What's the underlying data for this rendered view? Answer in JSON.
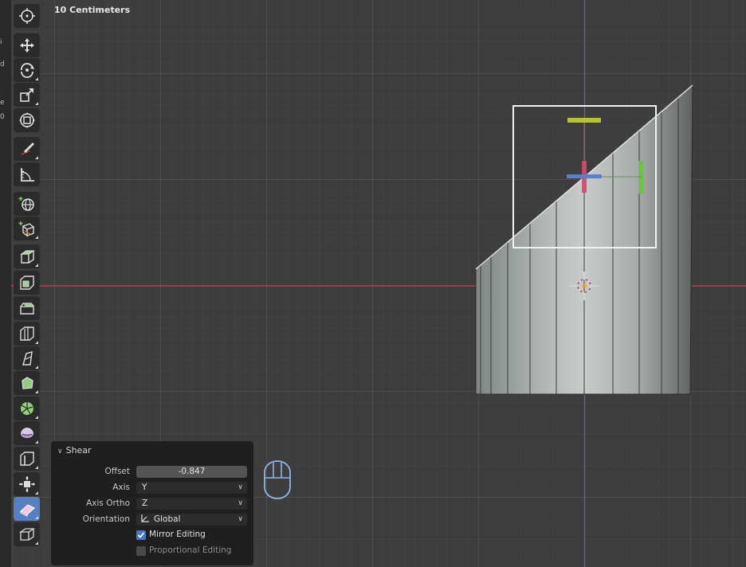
{
  "viewport": {
    "units_label": "10 Centimeters",
    "left_strip_chars": [
      "i",
      "d",
      "e",
      "0"
    ]
  },
  "toolbar": {
    "tools": [
      {
        "name": "cursor-tool-button",
        "icon": "cursor-target-icon",
        "active": false
      },
      {
        "name": "move-tool-button",
        "icon": "move-arrows-icon",
        "active": false
      },
      {
        "name": "rotate-tool-button",
        "icon": "rotate-icon",
        "active": false
      },
      {
        "name": "scale-tool-button",
        "icon": "scale-icon",
        "active": false
      },
      {
        "name": "transform-tool-button",
        "icon": "transform-icon",
        "active": false
      },
      {
        "name": "annotate-tool-button",
        "icon": "annotate-pen-icon",
        "active": false
      },
      {
        "name": "measure-tool-button",
        "icon": "measure-ruler-icon",
        "active": false
      },
      {
        "name": "add-object-tool-button",
        "icon": "add-globe-icon",
        "active": false
      },
      {
        "name": "add-cube-tool-button",
        "icon": "add-cube-icon",
        "active": false
      },
      {
        "name": "extrude-tool-button",
        "icon": "extrude-icon",
        "active": false
      },
      {
        "name": "inset-tool-button",
        "icon": "inset-icon",
        "active": false
      },
      {
        "name": "bevel-tool-button",
        "icon": "bevel-icon",
        "active": false
      },
      {
        "name": "loop-cut-tool-button",
        "icon": "loop-cut-icon",
        "active": false
      },
      {
        "name": "knife-tool-button",
        "icon": "knife-icon",
        "active": false
      },
      {
        "name": "poly-build-tool-button",
        "icon": "poly-build-icon",
        "active": false
      },
      {
        "name": "spin-tool-button",
        "icon": "spin-icon",
        "active": false
      },
      {
        "name": "smooth-tool-button",
        "icon": "smooth-sphere-icon",
        "active": false
      },
      {
        "name": "edge-slide-tool-button",
        "icon": "edge-slide-icon",
        "active": false
      },
      {
        "name": "shrink-fatten-tool-button",
        "icon": "shrink-fatten-icon",
        "active": false
      },
      {
        "name": "shear-tool-button",
        "icon": "shear-icon",
        "active": true
      },
      {
        "name": "rip-region-tool-button",
        "icon": "rip-region-icon",
        "active": false
      }
    ]
  },
  "operator_panel": {
    "title": "Shear",
    "offset_label": "Offset",
    "offset_value": "-0.847",
    "axis_label": "Axis",
    "axis_value": "Y",
    "axis_ortho_label": "Axis Ortho",
    "axis_ortho_value": "Z",
    "orientation_label": "Orientation",
    "orientation_value": "Global",
    "mirror_editing_label": "Mirror Editing",
    "mirror_editing_checked": true,
    "proportional_editing_label": "Proportional Editing",
    "proportional_editing_checked": false
  },
  "colors": {
    "x_axis_line": "#b8424f",
    "y_axis_line": "#4a72b8",
    "active_tool": "#5680c2",
    "panel_bg": "#1f1f1f"
  }
}
